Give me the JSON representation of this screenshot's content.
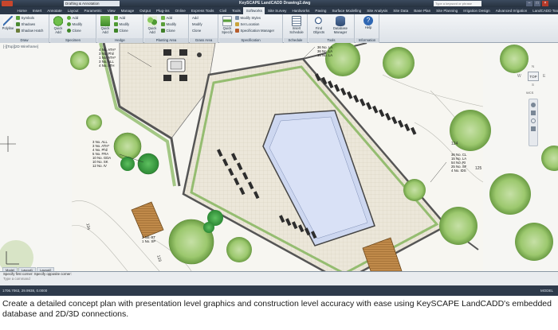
{
  "window": {
    "title": "KeySCAPE LandCADD   Drawing2.dwg",
    "workspace": "Drafting & Annotation",
    "search_placeholder": "Type a keyword or phrase",
    "user": "Sign In"
  },
  "tabs": [
    "Home",
    "Insert",
    "Annotate",
    "Layout",
    "Parametric",
    "View",
    "Manage",
    "Output",
    "Plug-ins",
    "Online",
    "Express Tools",
    "Civil",
    "Tools",
    "Softworks",
    "Site Survey",
    "Hardworks",
    "Paving",
    "Surface Modelling",
    "Site Analysis",
    "Site Data",
    "Base Plan",
    "Site Planning",
    "Irrigation Design",
    "Advanced Irrigation",
    "LandCADD Tools"
  ],
  "active_tab": "Softworks",
  "ribbon": {
    "draw": {
      "label": "Draw",
      "polyline": "Polyline",
      "symbols": "Symbols",
      "shadows": "Shadows",
      "shadow_hatch": "Shadow Hatch"
    },
    "specimen": {
      "label": "Specimen",
      "quick_add": "Quick Add",
      "add": "Add",
      "modify": "Modify",
      "clone": "Clone"
    },
    "hedge": {
      "label": "Hedge",
      "quick_add": "Quick Add",
      "add": "Add",
      "modify": "Modify",
      "clone": "Clone"
    },
    "planting_area": {
      "label": "Planting Area",
      "quick_add": "Quick Add",
      "add": "Add",
      "modify": "Modify",
      "clone": "Clone"
    },
    "grass_area": {
      "label": "Grass Area",
      "add": "Add",
      "modify": "Modify",
      "clone": "Clone"
    },
    "specification": {
      "label": "Specification",
      "quick_specify": "Quick Specify",
      "modify_styles": "Modify Styles",
      "set_location": "Set Location",
      "spec_manager": "Specification Manager"
    },
    "schedule": {
      "label": "Schedule",
      "insert_schedule": "Insert Schedule"
    },
    "tools": {
      "label": "Tools",
      "find_objects": "Find Objects",
      "database_manager": "Database Manager"
    },
    "information": {
      "label": "Information",
      "help": "Help"
    }
  },
  "viewport": {
    "label": "[-][Top][2D Wireframe]",
    "cube_top": "TOP",
    "cube_n": "N",
    "cube_s": "S",
    "cube_e": "E",
    "cube_w": "W",
    "wcs": "WCS"
  },
  "plant_labels_left": [
    "4 No. ATH*",
    "3 No. Phil",
    "1 No. ATH*",
    "3 No. ALL",
    "4 No. ATH"
  ],
  "plant_labels_mid": [
    "3 No. ALL",
    "3 No. ATH*",
    "4 No. Phil",
    "5 No. FRA",
    "10 No. GDA",
    "10 No. SK",
    "12 No. IV"
  ],
  "plant_labels_top": [
    "36 No. LA",
    "36 No. LA",
    "15 No. LA"
  ],
  "plant_labels_right": [
    "36 No. CL",
    "15 No. LA",
    "54 No. RI",
    "25 No. SF",
    "4 No. IDS"
  ],
  "plant_labels_low": [
    "2 No. RT",
    "1 No. SP"
  ],
  "contours": [
    "124",
    "125",
    "134",
    "133"
  ],
  "layout_tabs": [
    "Model",
    "Layout1",
    "Layout2"
  ],
  "command_history": [
    "Specify first corner: Specify opposite corner:",
    "Type a command"
  ],
  "status": {
    "coords": "1706.7063, 29.9938, 0.0000",
    "right": "MODEL"
  },
  "caption": "Create a detailed concept plan with presentation level graphics and construction level accuracy with ease using KeySCAPE LandCADD's embedded database and 2D/3D connections.",
  "colors": {
    "ribbon_bg": "#e6eaee",
    "accent": "#2c3848",
    "tree_green": "#9cc86e",
    "pool": "#c9d4f0",
    "paving": "#e8e3d6",
    "wall": "#555555",
    "deck": "#b07a3c"
  }
}
